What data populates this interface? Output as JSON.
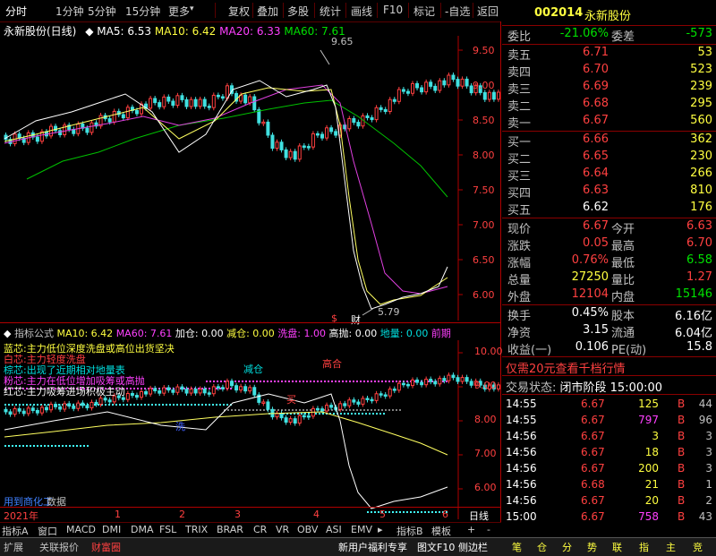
{
  "toolbar": {
    "items": [
      "分时",
      "1分钟",
      "5分钟",
      "15分钟",
      "更多",
      "复权",
      "叠加",
      "多股",
      "统计",
      "画线",
      "F10",
      "标记",
      "-自选",
      "返回"
    ]
  },
  "main_header": {
    "stock_period": "永新股份(日线)",
    "ma5": "MA5: 6.53",
    "ma10": "MA10: 6.42",
    "ma20": "MA20: 6.33",
    "ma60": "MA60: 7.61"
  },
  "price_axis": [
    "9.50",
    "9.00",
    "8.50",
    "8.00",
    "7.50",
    "7.00",
    "6.50",
    "6.00"
  ],
  "annotations": {
    "high": "9.65",
    "low": "5.79",
    "cai": "财",
    "dollar": "$"
  },
  "indicator_header": {
    "name": "指标公式",
    "ma10": "MA10: 6.42",
    "ma60": "MA60: 7.61",
    "jiacang": "加仓: 0.00",
    "jiancang": "减仓: 0.00",
    "xipan": "洗盘: 1.00",
    "gaopao": "高抛: 0.00",
    "diliang": "地量: 0.00",
    "qianjing": "前期"
  },
  "indicator_axis": [
    "10.00",
    "9.00",
    "8.00",
    "7.00",
    "6.00"
  ],
  "indicator_notes": [
    "蓝芯:主力低位深度洗盘或高位出货坚决",
    "白芯:主力轻度洗盘",
    "棕芯:出现了近期相对地量表",
    "粉芯:主力在低位增加吸筹或高抛",
    "红芯:主力吸筹进场积极主动"
  ],
  "indicator_labels": {
    "jian": "减仓",
    "gaopao": "高合",
    "mai": "买",
    "xi": "洗",
    "tail": "用到商化工",
    "shuju": "数据"
  },
  "time_axis": {
    "year": "2021年",
    "months": [
      "1",
      "2",
      "3",
      "4",
      "5",
      "6"
    ],
    "period": "日线"
  },
  "tabs": [
    "指标A",
    "窗口",
    "MACD",
    "DMI",
    "DMA",
    "FSL",
    "TRIX",
    "BRAR",
    "CR",
    "VR",
    "OBV",
    "ASI",
    "EMV",
    "指标B",
    "模板",
    "+",
    "-"
  ],
  "status": {
    "left": [
      "扩展",
      "关联报价",
      "财富圈"
    ],
    "middle": "新用户福利专享",
    "f10": "图文F10",
    "side": "侧边栏",
    "icons": [
      "笔",
      "仓",
      "分",
      "势",
      "联",
      "指",
      "主",
      "竞"
    ]
  },
  "quote": {
    "code": "002014",
    "name": "永新股份",
    "weibi_label": "委比",
    "weibi": "-21.06%",
    "weicha_label": "委差",
    "weicha": "-573",
    "sell": [
      {
        "label": "卖五",
        "price": "6.71",
        "vol": "53"
      },
      {
        "label": "卖四",
        "price": "6.70",
        "vol": "523"
      },
      {
        "label": "卖三",
        "price": "6.69",
        "vol": "239"
      },
      {
        "label": "卖二",
        "price": "6.68",
        "vol": "295"
      },
      {
        "label": "卖一",
        "price": "6.67",
        "vol": "560"
      }
    ],
    "buy": [
      {
        "label": "买一",
        "price": "6.66",
        "vol": "362"
      },
      {
        "label": "买二",
        "price": "6.65",
        "vol": "230"
      },
      {
        "label": "买三",
        "price": "6.64",
        "vol": "266"
      },
      {
        "label": "买四",
        "price": "6.63",
        "vol": "810"
      },
      {
        "label": "买五",
        "price": "6.62",
        "vol": "176"
      }
    ],
    "stats": [
      {
        "l1": "现价",
        "v1": "6.67",
        "l2": "今开",
        "v2": "6.63"
      },
      {
        "l1": "涨跌",
        "v1": "0.05",
        "l2": "最高",
        "v2": "6.70"
      },
      {
        "l1": "涨幅",
        "v1": "0.76%",
        "l2": "最低",
        "v2": "6.58"
      },
      {
        "l1": "总量",
        "v1": "27250",
        "l2": "量比",
        "v2": "1.27"
      },
      {
        "l1": "外盘",
        "v1": "12104",
        "l2": "内盘",
        "v2": "15146"
      }
    ],
    "stats2": [
      {
        "l1": "换手",
        "v1": "0.45%",
        "l2": "股本",
        "v2": "6.16亿"
      },
      {
        "l1": "净资",
        "v1": "3.15",
        "l2": "流通",
        "v2": "6.04亿"
      },
      {
        "l1": "收益(一)",
        "v1": "0.106",
        "l2": "PE(动)",
        "v2": "15.8"
      }
    ],
    "promo": "仅需20元查看千档行情",
    "trade_status_label": "交易状态:",
    "trade_status": "闭市阶段 15:00:00",
    "ticks": [
      {
        "t": "14:55",
        "p": "6.67",
        "v": "125",
        "s": "B",
        "n": "44"
      },
      {
        "t": "14:55",
        "p": "6.67",
        "v": "797",
        "s": "B",
        "n": "96"
      },
      {
        "t": "14:56",
        "p": "6.67",
        "v": "3",
        "s": "B",
        "n": "3"
      },
      {
        "t": "14:56",
        "p": "6.67",
        "v": "18",
        "s": "B",
        "n": "3"
      },
      {
        "t": "14:56",
        "p": "6.67",
        "v": "200",
        "s": "B",
        "n": "3"
      },
      {
        "t": "14:56",
        "p": "6.68",
        "v": "21",
        "s": "B",
        "n": "1"
      },
      {
        "t": "14:56",
        "p": "6.67",
        "v": "20",
        "s": "B",
        "n": "2"
      },
      {
        "t": "15:00",
        "p": "6.67",
        "v": "758",
        "s": "B",
        "n": "43"
      }
    ]
  }
}
